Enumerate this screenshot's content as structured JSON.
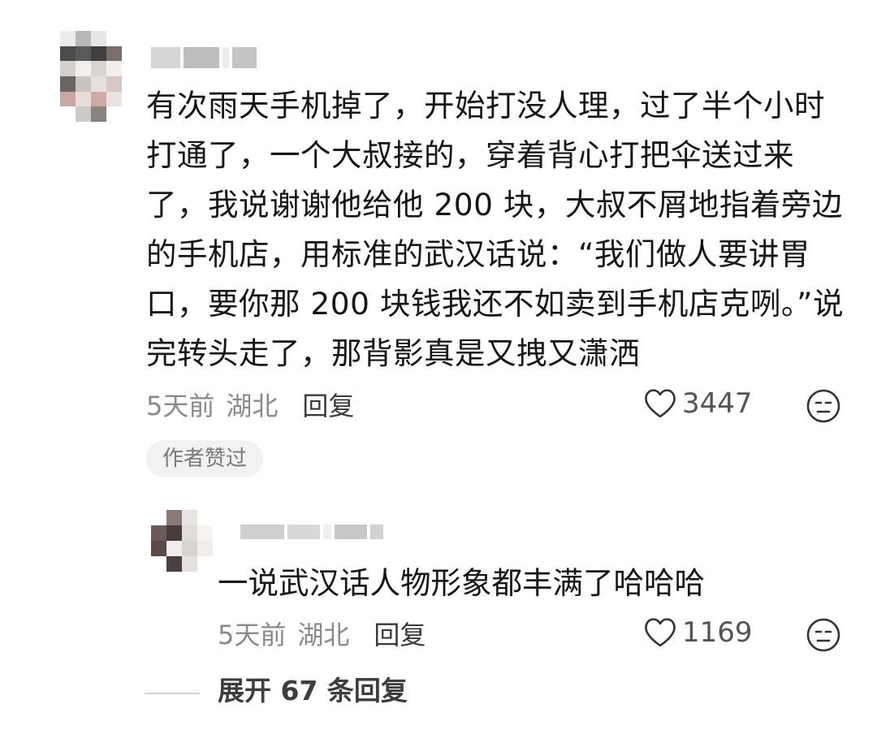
{
  "comment": {
    "avatar_pixels": [
      "#ececec",
      "#b8b8b8",
      "#e6e6e6",
      "#ffffff",
      "#4c4c4c",
      "#5c5a58",
      "#3f3f3f",
      "#7a6f6a",
      "#d4d0cc",
      "#f2f0ee",
      "#d8d4d0",
      "#f3eeec",
      "#6a6462",
      "#c8c4c2",
      "#e4e0de",
      "#d8c8c4",
      "#c8a8a4",
      "#e6dcda",
      "#d0a8a4",
      "#e8e2e0",
      "#ffffff",
      "#cfc9c6",
      "#8a8280",
      "#ffffff"
    ],
    "username_blocks": [
      36,
      44,
      8,
      30
    ],
    "text": "有次雨天手机掉了，开始打没人理，过了半个小时打通了，一个大叔接的，穿着背心打把伞送过来了，我说谢谢他给他 200 块，大叔不屑地指着旁边的手机店，用标准的武汉话说：“我们做人要讲胃口，要你那 200 块钱我还不如卖到手机店克咧。”说完转头走了，那背影真是又拽又潇洒",
    "time": "5天前",
    "location": "湖北",
    "reply_label": "回复",
    "likes": "3447",
    "author_badge": "作者赞过"
  },
  "reply": {
    "avatar_pixels": [
      "#ffffff",
      "#8a7a76",
      "#e8e4e2",
      "#ffffff",
      "#6a5a58",
      "#4a3c3a",
      "#e0dcda",
      "#f4f4f4",
      "#5a4a48",
      "#f0eeec",
      "#d8d4d2",
      "#eeeeee",
      "#ffffff",
      "#4a4040",
      "#e4e0de",
      "#ffffff"
    ],
    "username_blocks": [
      54,
      40,
      10,
      40,
      16
    ],
    "text": "一说武汉话人物形象都丰满了哈哈哈",
    "time": "5天前",
    "location": "湖北",
    "reply_label": "回复",
    "likes": "1169"
  },
  "expand_label": "展开 67 条回复",
  "colors": {
    "text": "#161616",
    "meta": "#8a8a8a",
    "badge_bg": "#f2f2f2"
  }
}
